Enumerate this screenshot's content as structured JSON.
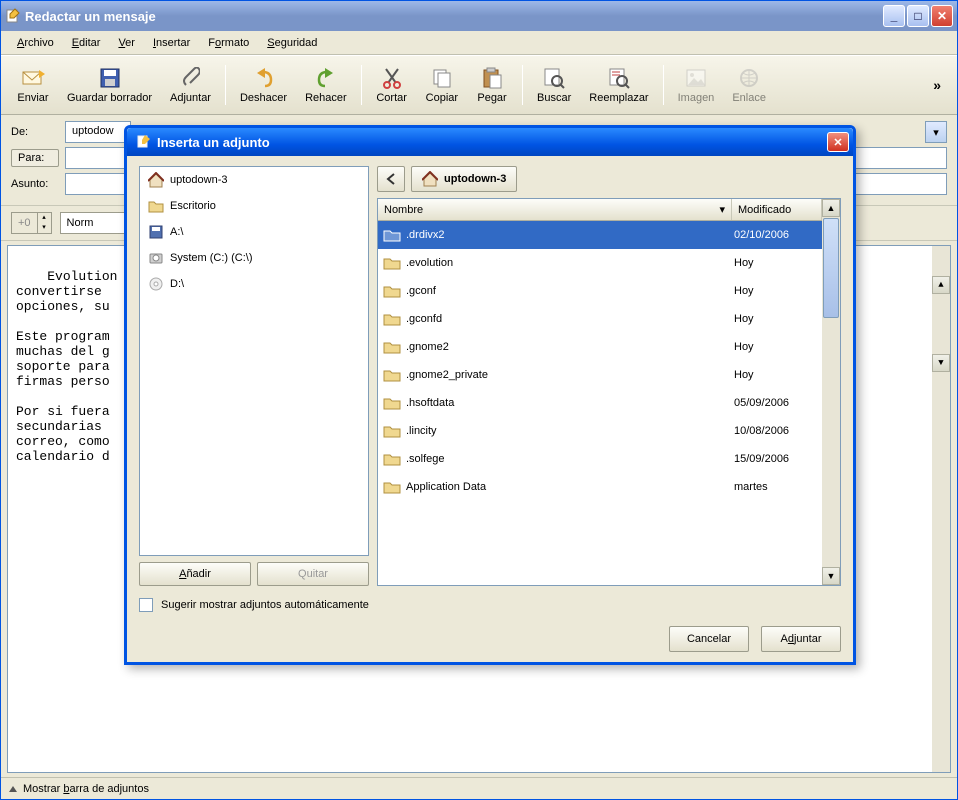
{
  "window": {
    "title": "Redactar un mensaje"
  },
  "menu": {
    "archivo": "Archivo",
    "editar": "Editar",
    "ver": "Ver",
    "insertar": "Insertar",
    "formato": "Formato",
    "seguridad": "Seguridad"
  },
  "toolbar": {
    "enviar": "Enviar",
    "guardar": "Guardar borrador",
    "adjuntar": "Adjuntar",
    "deshacer": "Deshacer",
    "rehacer": "Rehacer",
    "cortar": "Cortar",
    "copiar": "Copiar",
    "pegar": "Pegar",
    "buscar": "Buscar",
    "reemplazar": "Reemplazar",
    "imagen": "Imagen",
    "enlace": "Enlace"
  },
  "form": {
    "de_label": "De:",
    "de_value": "uptodow",
    "para_label": "Para:",
    "asunto_label": "Asunto:"
  },
  "format": {
    "size": "+0",
    "font": "Norm"
  },
  "editor_text": "Evolution es\nconvertirse \nopciones, su\n\nEste program\nmuchas del g\nsoporte para\nfirmas perso\n\nPor si fuera\nsecundarias \ncorreo, como\ncalendario d",
  "status": {
    "text": "Mostrar barra de adjuntos"
  },
  "dialog": {
    "title": "Inserta un adjunto",
    "places": [
      {
        "icon": "home",
        "label": "uptodown-3"
      },
      {
        "icon": "folder",
        "label": "Escritorio"
      },
      {
        "icon": "floppy",
        "label": "A:\\"
      },
      {
        "icon": "hdd",
        "label": "System (C:) (C:\\)"
      },
      {
        "icon": "cd",
        "label": "D:\\"
      }
    ],
    "add_btn": "Añadir",
    "remove_btn": "Quitar",
    "location": "uptodown-3",
    "columns": {
      "name": "Nombre",
      "modified": "Modificado"
    },
    "files": [
      {
        "name": ".drdivx2",
        "mod": "02/10/2006",
        "sel": true
      },
      {
        "name": ".evolution",
        "mod": "Hoy"
      },
      {
        "name": ".gconf",
        "mod": "Hoy"
      },
      {
        "name": ".gconfd",
        "mod": "Hoy"
      },
      {
        "name": ".gnome2",
        "mod": "Hoy"
      },
      {
        "name": ".gnome2_private",
        "mod": "Hoy"
      },
      {
        "name": ".hsoftdata",
        "mod": "05/09/2006"
      },
      {
        "name": ".lincity",
        "mod": "10/08/2006"
      },
      {
        "name": ".solfege",
        "mod": "15/09/2006"
      },
      {
        "name": "Application Data",
        "mod": "martes"
      }
    ],
    "suggest": "Sugerir mostrar adjuntos automáticamente",
    "cancel": "Cancelar",
    "attach": "Adjuntar"
  }
}
